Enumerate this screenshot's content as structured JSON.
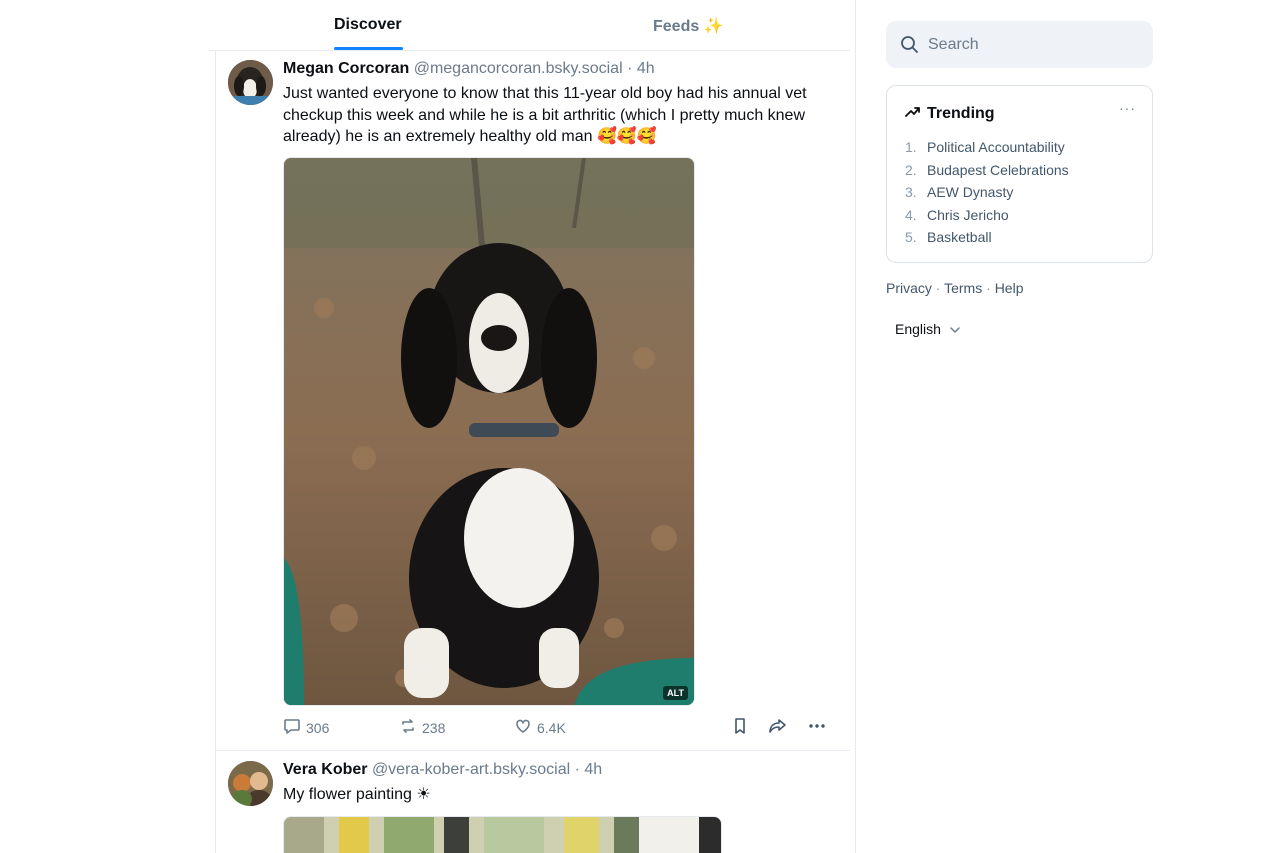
{
  "tabs": [
    {
      "label": "Discover",
      "active": true
    },
    {
      "label": "Feeds ✨",
      "active": false
    }
  ],
  "posts": [
    {
      "author": "Megan Corcoran",
      "handle": "@megancorcoran.bsky.social",
      "time": "· 4h",
      "text": "Just wanted everyone to know that this 11-year old boy had his annual vet checkup this week and while he is a bit arthritic (which I pretty much knew already) he is an extremely healthy old man 🥰🥰🥰",
      "alt_badge": "ALT",
      "replies": "306",
      "reposts": "238",
      "likes": "6.4K"
    },
    {
      "author": "Vera Kober",
      "handle": "@vera-kober-art.bsky.social",
      "time": "· 4h",
      "text": "My flower painting ☀"
    }
  ],
  "search": {
    "placeholder": "Search"
  },
  "trending": {
    "title": "Trending",
    "more": "···",
    "items": [
      {
        "num": "1.",
        "label": "Political Accountability"
      },
      {
        "num": "2.",
        "label": "Budapest Celebrations"
      },
      {
        "num": "3.",
        "label": "AEW Dynasty"
      },
      {
        "num": "4.",
        "label": "Chris Jericho"
      },
      {
        "num": "5.",
        "label": "Basketball"
      }
    ]
  },
  "footer": {
    "privacy": "Privacy",
    "terms": "Terms",
    "help": "Help",
    "sep": "·"
  },
  "language": {
    "selected": "English"
  },
  "colors": {
    "accent": "#1083fe",
    "muted": "#6a7b8c",
    "border": "#e6eaef"
  }
}
